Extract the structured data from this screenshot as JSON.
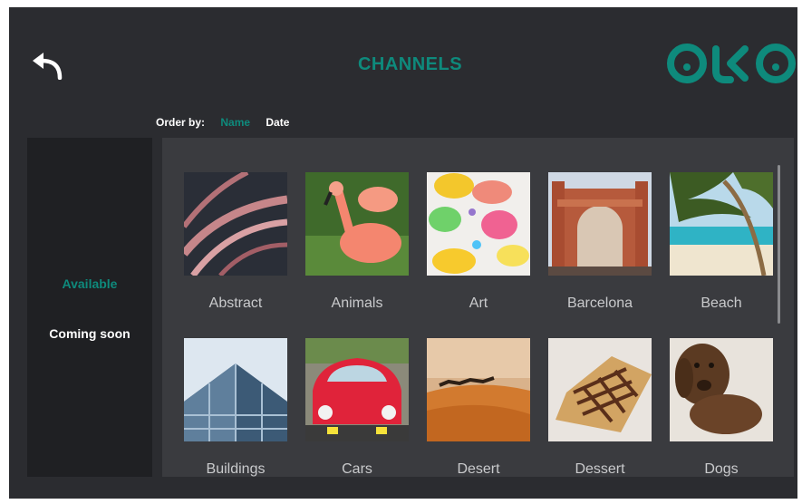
{
  "header": {
    "back_icon": "back-arrow-icon",
    "title": "CHANNELS",
    "logo_text": "OKO",
    "accent_color": "#0e8a7c"
  },
  "order": {
    "label": "Order by:",
    "options": [
      "Name",
      "Date"
    ],
    "active": "Name"
  },
  "sidebar": {
    "items": [
      "Available",
      "Coming soon"
    ],
    "active": "Available"
  },
  "channels": [
    "Abstract",
    "Animals",
    "Art",
    "Barcelona",
    "Beach",
    "Buildings",
    "Cars",
    "Desert",
    "Dessert",
    "Dogs"
  ]
}
